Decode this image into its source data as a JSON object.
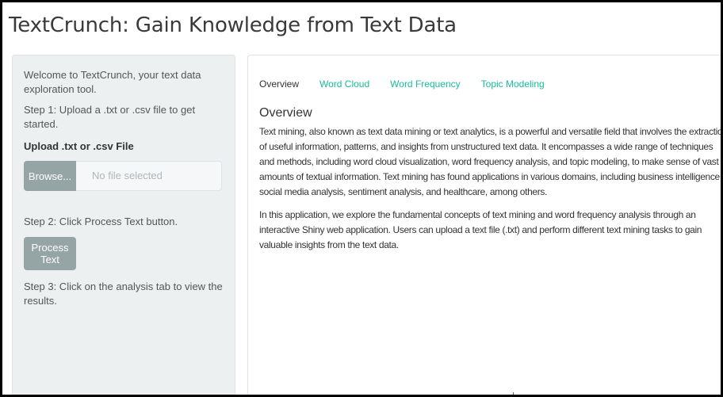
{
  "app": {
    "title": "TextCrunch: Gain Knowledge from Text Data"
  },
  "sidebar": {
    "welcome": "Welcome to TextCrunch, your text data exploration tool.",
    "step1": "Step 1: Upload a .txt or .csv file to get started.",
    "upload_label": "Upload .txt or .csv File",
    "browse_label": "Browse...",
    "file_status": "No file selected",
    "step2": "Step 2: Click Process Text button.",
    "process_label": "Process Text",
    "step3": "Step 3: Click on the analysis tab to view the results."
  },
  "tabs": [
    {
      "label": "Overview",
      "active": true
    },
    {
      "label": "Word Cloud",
      "active": false
    },
    {
      "label": "Word Frequency",
      "active": false
    },
    {
      "label": "Topic Modeling",
      "active": false
    }
  ],
  "overview": {
    "heading": "Overview",
    "paragraph1": "Text mining, also known as text data mining or text analytics, is a powerful and versatile field that involves the extraction of useful information, patterns, and insights from unstructured text data. It encompasses a wide range of techniques and methods, including word cloud visualization, word frequency analysis, and topic modeling, to make sense of vast amounts of textual information. Text mining has found applications in various domains, including business intelligence, social media analysis, sentiment analysis, and healthcare, among others.",
    "paragraph2": "In this application, we explore the fundamental concepts of text mining and word frequency analysis through an interactive Shiny web application. Users can upload a text file (.txt) and perform different text mining tasks to gain valuable insights from the text data."
  },
  "colors": {
    "accent": "#18bc9c",
    "sidebar_bg": "#ecf0f1",
    "button_bg": "#95a5a6"
  }
}
